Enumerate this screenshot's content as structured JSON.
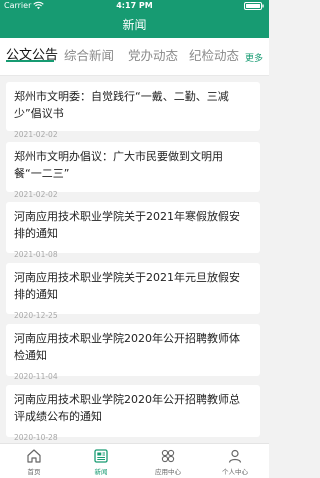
{
  "status_bar": {
    "carrier": "Carrier",
    "time": "4:17 PM"
  },
  "nav": {
    "title": "新闻"
  },
  "tabs": [
    {
      "label": "公文公告",
      "active": true
    },
    {
      "label": "综合新闻",
      "active": false
    },
    {
      "label": "党办动态",
      "active": false
    },
    {
      "label": "纪检动态",
      "active": false
    }
  ],
  "more_label": "更多",
  "articles": [
    {
      "title": "郑州市文明委：自觉践行“一戴、二勤、三减少”倡议书",
      "date": "2021-02-02"
    },
    {
      "title": "郑州市文明办倡议：广大市民要做到文明用餐“一二三”",
      "date": "2021-02-02"
    },
    {
      "title": "河南应用技术职业学院关于2021年寒假放假安排的通知",
      "date": "2021-01-08"
    },
    {
      "title": "河南应用技术职业学院关于2021年元旦放假安排的通知",
      "date": "2020-12-25"
    },
    {
      "title": "河南应用技术职业学院2020年公开招聘教师体检通知",
      "date": "2020-11-04"
    },
    {
      "title": "河南应用技术职业学院2020年公开招聘教师总评成绩公布的通知",
      "date": "2020-10-28"
    }
  ],
  "tabbar": [
    {
      "label": "首页",
      "icon": "home-icon",
      "active": false
    },
    {
      "label": "新闻",
      "icon": "news-icon",
      "active": true
    },
    {
      "label": "应用中心",
      "icon": "app-center-icon",
      "active": false
    },
    {
      "label": "个人中心",
      "icon": "profile-icon",
      "active": false
    }
  ],
  "colors": {
    "brand": "#179b72",
    "background": "#f2f2f2"
  }
}
